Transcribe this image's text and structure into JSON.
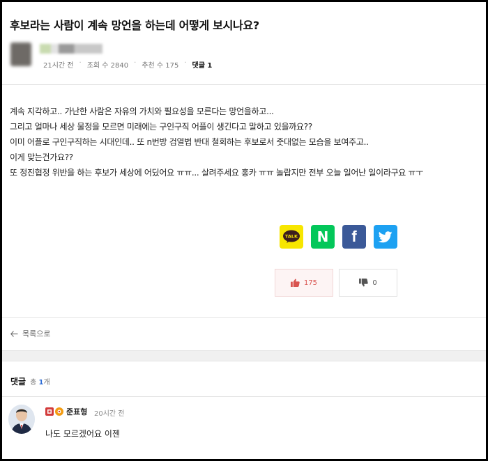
{
  "post": {
    "title": "후보라는 사람이 계속 망언을 하는데 어떻게 보시나요?",
    "time": "21시간 전",
    "views": "조회 수 2840",
    "recommends": "추천 수 175",
    "comments_link": "댓글 1",
    "separator": "·",
    "body_lines": [
      "계속 지각하고.. 가난한 사람은 자유의 가치와 필요성을 모른다는 망언을하고...",
      "그리고 얼마나 세상 물정을 모르면 미래에는 구인구직 어플이 생긴다고 말하고 있을까요??",
      "이미 어플로 구인구직하는 시대인데.. 또 n번방 검열법 반대 철회하는 후보로서 줏대없는 모습을 보여주고..",
      "이게 맞는건가요??",
      "또 정진협정 위반을 하는 후보가 세상에 어딨어요 ㅠㅠ... 살려주세요 홍카 ㅠㅠ 놀랍지만 전부 오늘 일어난 일이라구요 ㅠㅜ"
    ]
  },
  "share": {
    "kakao_text": "TALK",
    "naver_text": "N",
    "facebook_text": "f",
    "colors": {
      "kakao": "#f7e600",
      "naver": "#03c75a",
      "facebook": "#3b5998",
      "twitter": "#1da1f2"
    }
  },
  "votes": {
    "up": "175",
    "down": "0"
  },
  "nav": {
    "list_label": "목록으로"
  },
  "comments": {
    "label": "댓글",
    "total_prefix": "총",
    "total_count": "1",
    "total_suffix": "개",
    "items": [
      {
        "author": "준표형",
        "time": "20시간 전",
        "text": "나도 모르겠어요 이젠"
      }
    ]
  }
}
